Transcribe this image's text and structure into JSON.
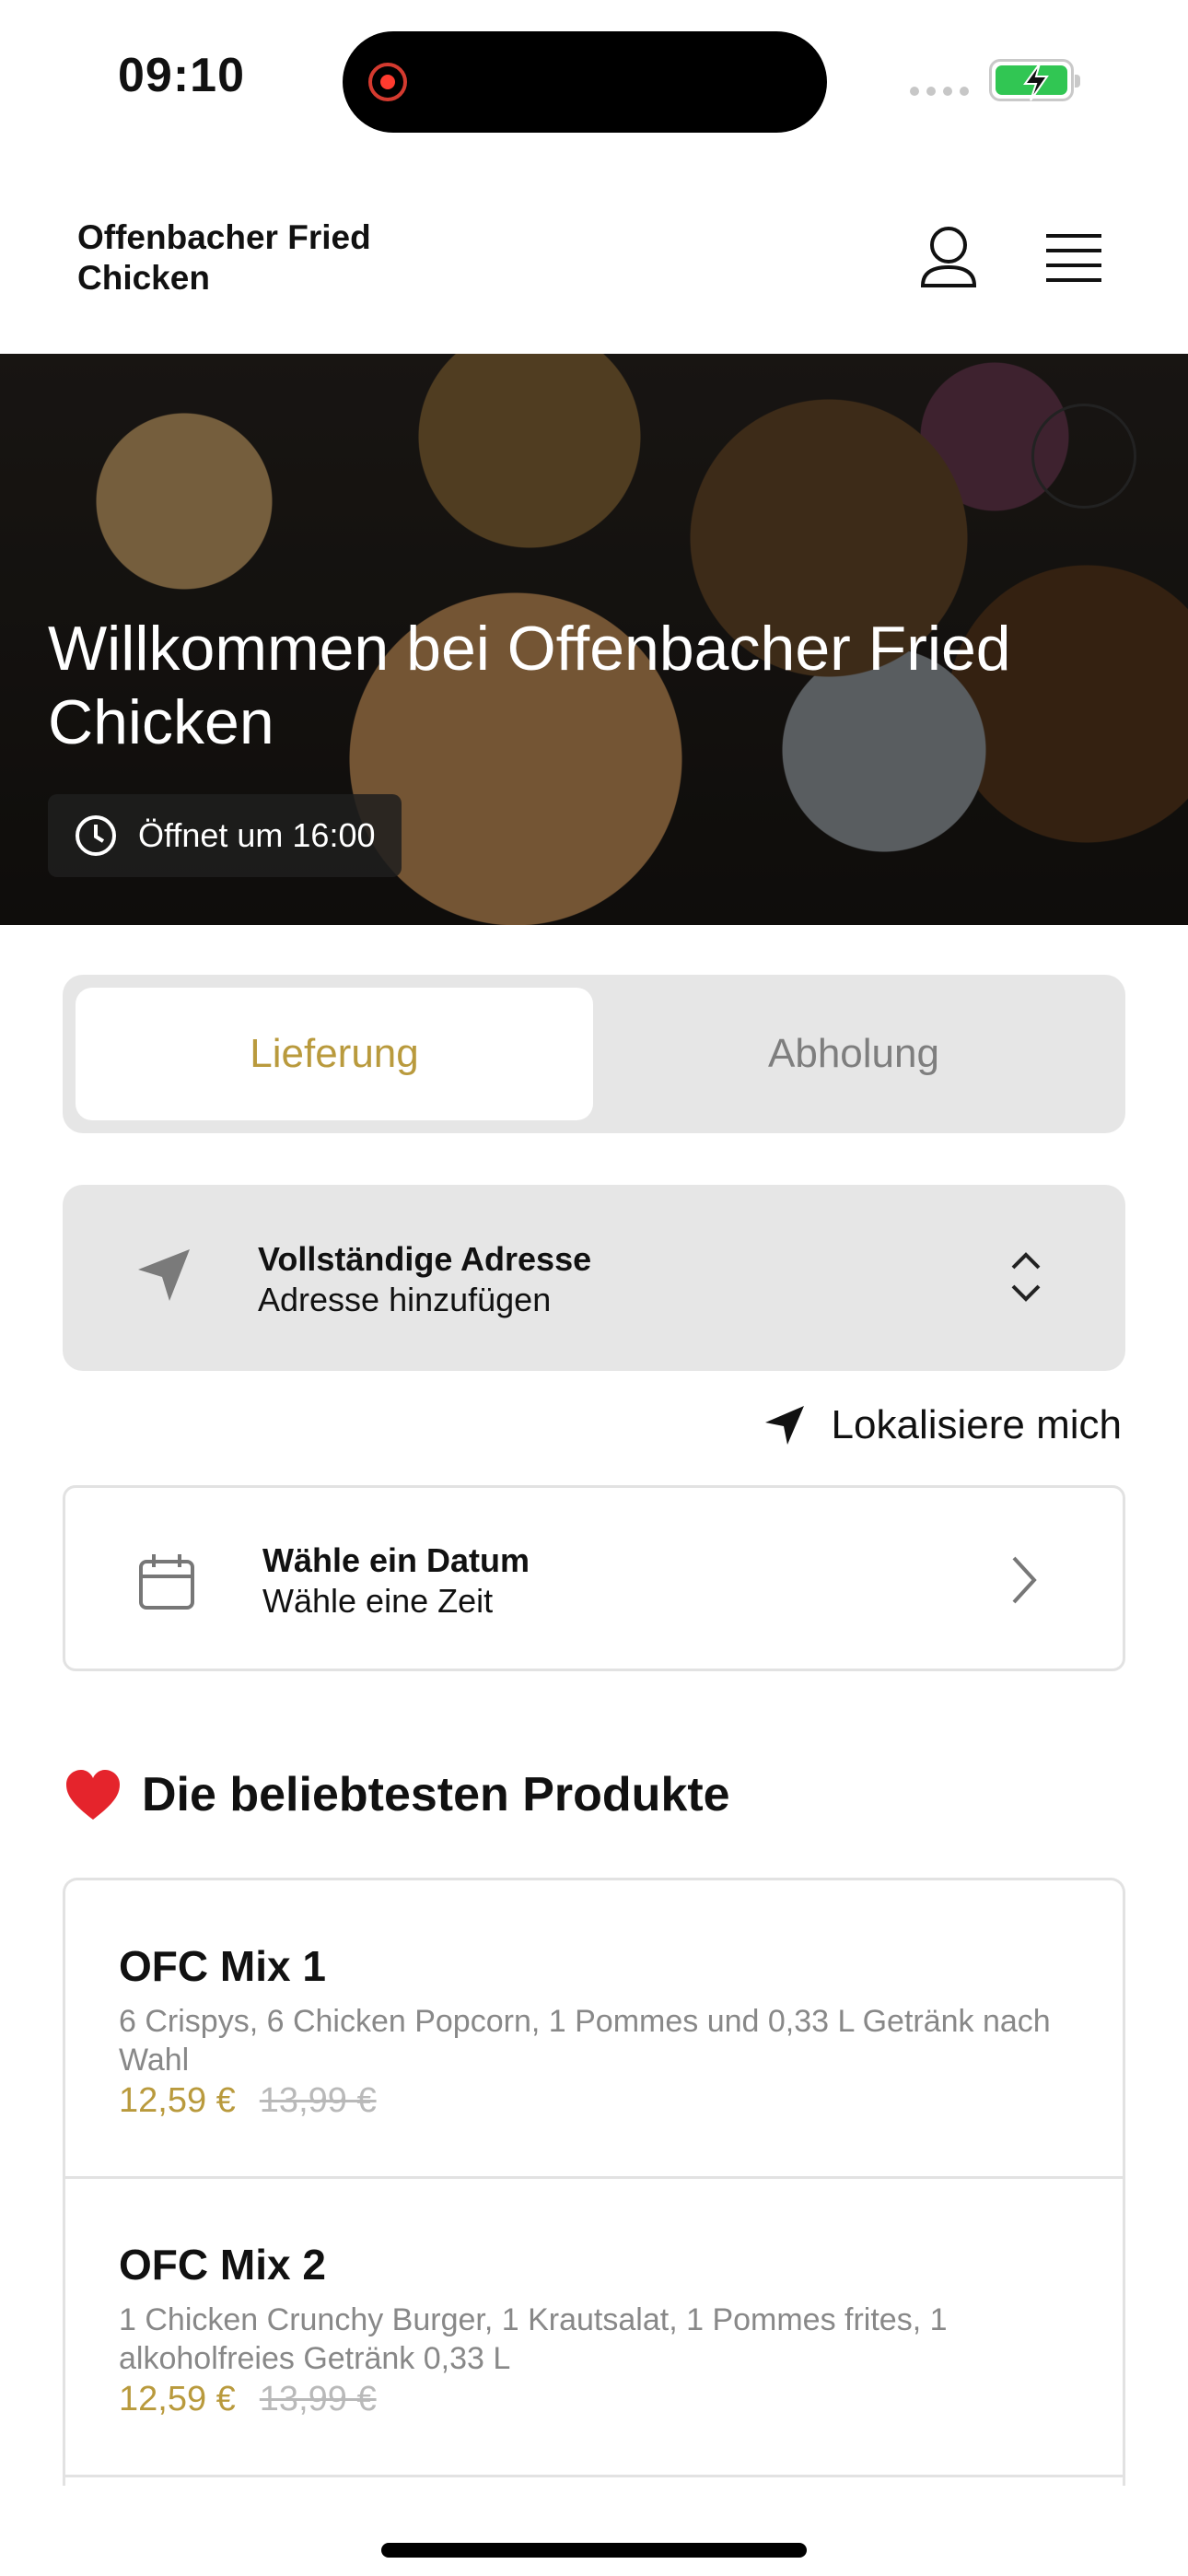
{
  "status": {
    "time": "09:10"
  },
  "header": {
    "brand": "Offenbacher Fried Chicken"
  },
  "hero": {
    "title": "Willkommen bei Offenbacher Fried Chicken",
    "opening": "Öffnet um 16:00"
  },
  "tabs": [
    {
      "label": "Lieferung",
      "active": true
    },
    {
      "label": "Abholung",
      "active": false
    }
  ],
  "address": {
    "title": "Vollständige Adresse",
    "subtitle": "Adresse hinzufügen"
  },
  "locate": {
    "label": "Lokalisiere mich"
  },
  "date": {
    "title": "Wähle ein Datum",
    "subtitle": "Wähle eine Zeit"
  },
  "popular": {
    "emoji": "❤️",
    "heading": "Die beliebtesten Produkte",
    "products": [
      {
        "name": "OFC Mix 1",
        "description": "6 Crispys, 6 Chicken Popcorn, 1 Pommes und 0,33 L Getränk nach Wahl",
        "price": "12,59 €",
        "old_price": "13,99 €"
      },
      {
        "name": "OFC Mix 2",
        "description": "1 Chicken Crunchy Burger, 1 Krautsalat, 1 Pommes frites, 1 alkoholfreies Getränk 0,33 L",
        "price": "12,59 €",
        "old_price": "13,99 €"
      }
    ]
  },
  "colors": {
    "accent": "#b99a3d",
    "battery": "#31c653",
    "recording": "#ff3b2f",
    "panel": "#e6e6e6"
  },
  "icons": [
    "user-icon",
    "menu-icon",
    "clock-icon",
    "navigation-icon",
    "chevron-updown-icon",
    "location-arrow-icon",
    "calendar-icon",
    "chevron-right-icon",
    "heart-icon"
  ]
}
